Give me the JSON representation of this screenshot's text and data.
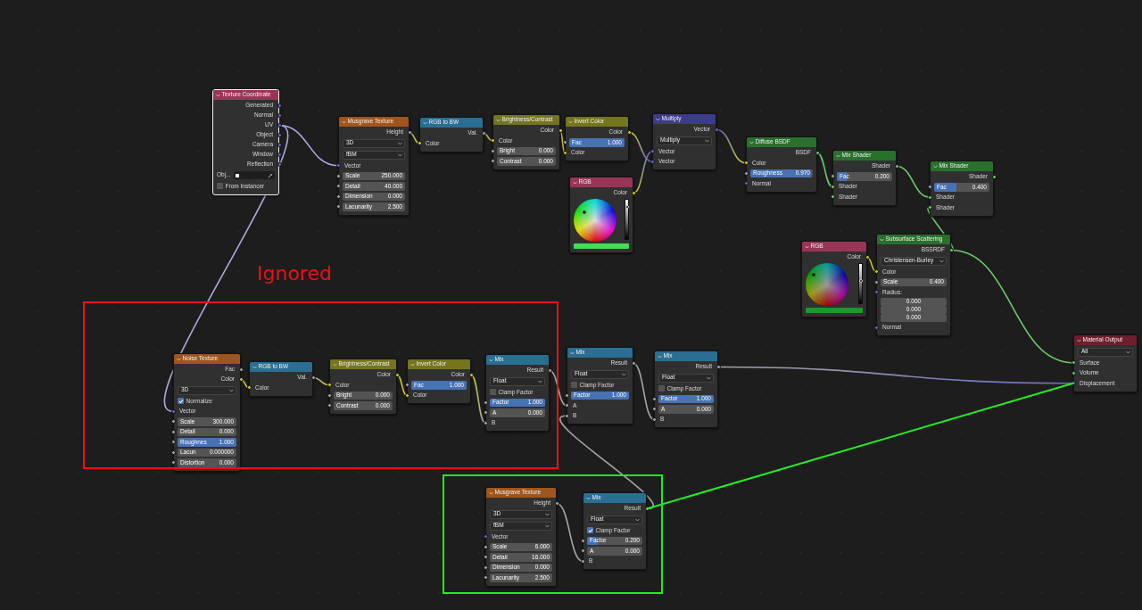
{
  "node_editor": {
    "nodes": [
      {
        "title": "Texture Coordinate",
        "color": "#9a3558",
        "selected": true,
        "rows": [
          {
            "kind": "output",
            "label": "Generated",
            "socket": {
              "kind": "vector"
            }
          },
          {
            "kind": "output",
            "label": "Normal",
            "socket": {
              "kind": "vector"
            }
          },
          {
            "kind": "output",
            "label": "UV",
            "socket": {
              "kind": "vector"
            }
          },
          {
            "kind": "output",
            "label": "Object",
            "socket": {
              "kind": "vector"
            }
          },
          {
            "kind": "output",
            "label": "Camera",
            "socket": {
              "kind": "vector"
            }
          },
          {
            "kind": "output",
            "label": "Window",
            "socket": {
              "kind": "vector"
            }
          },
          {
            "kind": "output",
            "label": "Reflection",
            "socket": {
              "kind": "vector"
            }
          },
          {
            "kind": "object",
            "label": "Obj..."
          },
          {
            "kind": "checkbox",
            "label": "From Instancer",
            "checked": false
          }
        ]
      },
      {
        "title": "Musgrave Texture",
        "color": "#9e561e",
        "selected": false,
        "rows": [
          {
            "kind": "output",
            "label": "Height",
            "socket": {
              "kind": "float"
            }
          },
          {
            "kind": "dropdown",
            "value": "3D"
          },
          {
            "kind": "dropdown",
            "value": "fBM"
          },
          {
            "kind": "input",
            "label": "Vector",
            "socket": {
              "kind": "vector"
            }
          },
          {
            "kind": "field",
            "label": "Scale",
            "value": "250.000",
            "socket": {
              "kind": "float"
            }
          },
          {
            "kind": "field",
            "label": "Detail",
            "value": "40.000",
            "socket": {
              "kind": "float"
            }
          },
          {
            "kind": "field",
            "label": "Dimension",
            "value": "0.000",
            "socket": {
              "kind": "float"
            }
          },
          {
            "kind": "field",
            "label": "Lacunarity",
            "value": "2.500",
            "socket": {
              "kind": "float"
            }
          }
        ]
      },
      {
        "title": "RGB to BW",
        "color": "#2a6f93",
        "selected": false,
        "rows": [
          {
            "kind": "output",
            "label": "Val.",
            "socket": {
              "kind": "float"
            }
          },
          {
            "kind": "input",
            "label": "Color",
            "socket": {
              "kind": "color"
            }
          }
        ]
      },
      {
        "title": "Brightness/Contrast",
        "color": "#75751f",
        "selected": false,
        "rows": [
          {
            "kind": "output",
            "label": "Color",
            "socket": {
              "kind": "color"
            }
          },
          {
            "kind": "input",
            "label": "Color",
            "socket": {
              "kind": "color"
            }
          },
          {
            "kind": "field",
            "label": "Bright",
            "value": "0.000",
            "socket": {
              "kind": "float"
            }
          },
          {
            "kind": "field",
            "label": "Contrast",
            "value": "0.000",
            "socket": {
              "kind": "float"
            }
          }
        ]
      },
      {
        "title": "Invert Color",
        "color": "#75751f",
        "selected": false,
        "rows": [
          {
            "kind": "output",
            "label": "Color",
            "socket": {
              "kind": "color"
            }
          },
          {
            "kind": "field",
            "label": "Fac",
            "value": "1.000",
            "level": 1,
            "socket": {
              "kind": "float"
            }
          },
          {
            "kind": "input",
            "label": "Color",
            "socket": {
              "kind": "color"
            }
          }
        ]
      },
      {
        "title": "Multiply",
        "color": "#3c3c8a",
        "selected": false,
        "rows": [
          {
            "kind": "output",
            "label": "Vector",
            "socket": {
              "kind": "vector"
            }
          },
          {
            "kind": "dropdown",
            "value": "Multiply"
          },
          {
            "kind": "input",
            "label": "Vector",
            "socket": {
              "kind": "vector"
            }
          },
          {
            "kind": "input",
            "label": "Vector",
            "socket": {
              "kind": "vector"
            }
          }
        ]
      },
      {
        "title": "RGB",
        "color": "#9a3558",
        "selected": false,
        "rows": [
          {
            "kind": "output",
            "label": "Color",
            "socket": {
              "kind": "color"
            }
          },
          {
            "kind": "picker",
            "color": "#44dd55"
          }
        ]
      },
      {
        "title": "Diffuse BSDF",
        "color": "#28702c",
        "selected": false,
        "rows": [
          {
            "kind": "output",
            "label": "BSDF",
            "socket": {
              "kind": "shader"
            }
          },
          {
            "kind": "input",
            "label": "Color",
            "socket": {
              "kind": "color"
            }
          },
          {
            "kind": "field",
            "label": "Roughness",
            "value": "0.970",
            "level": 0.97,
            "socket": {
              "kind": "float"
            }
          },
          {
            "kind": "input",
            "label": "Normal",
            "socket": {
              "kind": "vector"
            }
          }
        ]
      },
      {
        "title": "Mix Shader",
        "color": "#28702c",
        "selected": false,
        "rows": [
          {
            "kind": "output",
            "label": "Shader",
            "socket": {
              "kind": "shader"
            }
          },
          {
            "kind": "field",
            "label": "Fac",
            "value": "0.200",
            "level": 0.2,
            "socket": {
              "kind": "float"
            }
          },
          {
            "kind": "input",
            "label": "Shader",
            "socket": {
              "kind": "shader"
            }
          },
          {
            "kind": "input",
            "label": "Shader",
            "socket": {
              "kind": "shader"
            }
          }
        ]
      },
      {
        "title": "Mix Shader",
        "color": "#28702c",
        "selected": false,
        "rows": [
          {
            "kind": "output",
            "label": "Shader",
            "socket": {
              "kind": "shader"
            }
          },
          {
            "kind": "field",
            "label": "Fac",
            "value": "0.400",
            "level": 0.4,
            "socket": {
              "kind": "float"
            }
          },
          {
            "kind": "input",
            "label": "Shader",
            "socket": {
              "kind": "shader"
            }
          },
          {
            "kind": "input",
            "label": "Shader",
            "socket": {
              "kind": "shader"
            }
          }
        ]
      },
      {
        "title": "RGB",
        "color": "#9a3558",
        "selected": false,
        "rows": [
          {
            "kind": "output",
            "label": "Color",
            "socket": {
              "kind": "color"
            }
          },
          {
            "kind": "picker",
            "color": "#1a9a2a"
          }
        ]
      },
      {
        "title": "Subsurface Scattering",
        "color": "#28702c",
        "selected": false,
        "rows": [
          {
            "kind": "output",
            "label": "BSSRDF",
            "socket": {
              "kind": "shader"
            }
          },
          {
            "kind": "dropdown",
            "value": "Christensen-Burley"
          },
          {
            "kind": "input",
            "label": "Color",
            "socket": {
              "kind": "color"
            }
          },
          {
            "kind": "field",
            "label": "Scale",
            "value": "0.400",
            "socket": {
              "kind": "float"
            }
          },
          {
            "kind": "input",
            "label": "Radius:",
            "socket": {
              "kind": "vector"
            }
          },
          {
            "kind": "values",
            "values": [
              "0.000",
              "0.000",
              "0.000"
            ]
          },
          {
            "kind": "input",
            "label": "Normal",
            "socket": {
              "kind": "vector"
            }
          }
        ]
      },
      {
        "title": "Material Output",
        "color": "#6e1f2c",
        "selected": false,
        "rows": [
          {
            "kind": "dropdown",
            "value": "All"
          },
          {
            "kind": "input",
            "label": "Surface",
            "socket": {
              "kind": "shader"
            }
          },
          {
            "kind": "input",
            "label": "Volume",
            "socket": {
              "kind": "shader"
            }
          },
          {
            "kind": "input",
            "label": "Displacement",
            "socket": {
              "kind": "vector"
            }
          }
        ]
      },
      {
        "title": "Noise Texture",
        "color": "#9e561e",
        "selected": false,
        "rows": [
          {
            "kind": "output",
            "label": "Fac",
            "socket": {
              "kind": "float"
            }
          },
          {
            "kind": "output",
            "label": "Color",
            "socket": {
              "kind": "color"
            }
          },
          {
            "kind": "dropdown",
            "value": "3D"
          },
          {
            "kind": "checkbox",
            "label": "Normalize",
            "checked": true
          },
          {
            "kind": "input",
            "label": "Vector",
            "socket": {
              "kind": "vector"
            }
          },
          {
            "kind": "field",
            "label": "Scale",
            "value": "300.000",
            "socket": {
              "kind": "float"
            }
          },
          {
            "kind": "field",
            "label": "Detail",
            "value": "0.000",
            "socket": {
              "kind": "float"
            }
          },
          {
            "kind": "field",
            "label": "Roughnes",
            "value": "1.000",
            "level": 1,
            "socket": {
              "kind": "float"
            }
          },
          {
            "kind": "field",
            "label": "Lacun",
            "value": "0.000000",
            "socket": {
              "kind": "float"
            }
          },
          {
            "kind": "field",
            "label": "Distortion",
            "value": "0.000",
            "socket": {
              "kind": "float"
            }
          }
        ]
      },
      {
        "title": "RGB to BW",
        "color": "#2a6f93",
        "selected": false,
        "rows": [
          {
            "kind": "output",
            "label": "Val.",
            "socket": {
              "kind": "float"
            }
          },
          {
            "kind": "input",
            "label": "Color",
            "socket": {
              "kind": "color"
            }
          }
        ]
      },
      {
        "title": "Brightness/Contrast",
        "color": "#75751f",
        "selected": false,
        "rows": [
          {
            "kind": "output",
            "label": "Color",
            "socket": {
              "kind": "color"
            }
          },
          {
            "kind": "input",
            "label": "Color",
            "socket": {
              "kind": "color"
            }
          },
          {
            "kind": "field",
            "label": "Bright",
            "value": "0.000",
            "socket": {
              "kind": "float"
            }
          },
          {
            "kind": "field",
            "label": "Contrast",
            "value": "0.000",
            "socket": {
              "kind": "float"
            }
          }
        ]
      },
      {
        "title": "Invert Color",
        "color": "#75751f",
        "selected": false,
        "rows": [
          {
            "kind": "output",
            "label": "Color",
            "socket": {
              "kind": "color"
            }
          },
          {
            "kind": "field",
            "label": "Fac",
            "value": "1.000",
            "level": 1,
            "socket": {
              "kind": "float"
            }
          },
          {
            "kind": "input",
            "label": "Color",
            "socket": {
              "kind": "color"
            }
          }
        ]
      },
      {
        "title": "Mix",
        "color": "#2a6f93",
        "selected": false,
        "rows": [
          {
            "kind": "output",
            "label": "Result",
            "socket": {
              "kind": "float"
            }
          },
          {
            "kind": "dropdown",
            "value": "Float"
          },
          {
            "kind": "checkbox",
            "label": "Clamp Factor",
            "checked": false
          },
          {
            "kind": "field",
            "label": "Factor",
            "value": "1.000",
            "level": 1,
            "socket": {
              "kind": "float"
            }
          },
          {
            "kind": "field",
            "label": "A",
            "value": "0.000",
            "socket": {
              "kind": "float"
            }
          },
          {
            "kind": "input",
            "label": "B",
            "socket": {
              "kind": "float"
            }
          }
        ]
      },
      {
        "title": "Mix",
        "color": "#2a6f93",
        "selected": false,
        "rows": [
          {
            "kind": "output",
            "label": "Result",
            "socket": {
              "kind": "float"
            }
          },
          {
            "kind": "dropdown",
            "value": "Float"
          },
          {
            "kind": "checkbox",
            "label": "Clamp Factor",
            "checked": false
          },
          {
            "kind": "field",
            "label": "Factor",
            "value": "1.000",
            "level": 1,
            "socket": {
              "kind": "float"
            }
          },
          {
            "kind": "input",
            "label": "A",
            "socket": {
              "kind": "float"
            }
          },
          {
            "kind": "input",
            "label": "B",
            "socket": {
              "kind": "float"
            }
          }
        ]
      },
      {
        "title": "Mix",
        "color": "#2a6f93",
        "selected": false,
        "rows": [
          {
            "kind": "output",
            "label": "Result",
            "socket": {
              "kind": "float"
            }
          },
          {
            "kind": "dropdown",
            "value": "Float"
          },
          {
            "kind": "checkbox",
            "label": "Clamp Factor",
            "checked": false
          },
          {
            "kind": "field",
            "label": "Factor",
            "value": "1.000",
            "level": 1,
            "socket": {
              "kind": "float"
            }
          },
          {
            "kind": "field",
            "label": "A",
            "value": "0.000",
            "socket": {
              "kind": "float"
            }
          },
          {
            "kind": "input",
            "label": "B",
            "socket": {
              "kind": "float"
            }
          }
        ]
      },
      {
        "title": "Musgrave Texture",
        "color": "#9e561e",
        "selected": false,
        "rows": [
          {
            "kind": "output",
            "label": "Height",
            "socket": {
              "kind": "float"
            }
          },
          {
            "kind": "dropdown",
            "value": "3D"
          },
          {
            "kind": "dropdown",
            "value": "fBM"
          },
          {
            "kind": "input",
            "label": "Vector",
            "socket": {
              "kind": "vector"
            }
          },
          {
            "kind": "field",
            "label": "Scale",
            "value": "6.000",
            "socket": {
              "kind": "float"
            }
          },
          {
            "kind": "field",
            "label": "Detail",
            "value": "16.000",
            "socket": {
              "kind": "float"
            }
          },
          {
            "kind": "field",
            "label": "Dimension",
            "value": "0.000",
            "socket": {
              "kind": "float"
            }
          },
          {
            "kind": "field",
            "label": "Lacunarity",
            "value": "2.500",
            "socket": {
              "kind": "float"
            }
          }
        ]
      },
      {
        "title": "Mix",
        "color": "#2a6f93",
        "selected": false,
        "rows": [
          {
            "kind": "output",
            "label": "Result",
            "socket": {
              "kind": "float"
            }
          },
          {
            "kind": "dropdown",
            "value": "Float"
          },
          {
            "kind": "checkbox",
            "label": "Clamp Factor",
            "checked": true
          },
          {
            "kind": "field",
            "label": "Factor",
            "value": "0.200",
            "level": 0.2,
            "socket": {
              "kind": "float"
            }
          },
          {
            "kind": "field",
            "label": "A",
            "value": "0.000",
            "socket": {
              "kind": "float"
            }
          },
          {
            "kind": "input",
            "label": "B",
            "socket": {
              "kind": "float"
            }
          }
        ]
      }
    ],
    "annotations": [
      {
        "kind": "frame",
        "color": "#ee1111",
        "label": "Ignored"
      },
      {
        "kind": "frame",
        "color": "#22ee22"
      },
      {
        "kind": "line",
        "color": "#22ee22"
      }
    ]
  }
}
